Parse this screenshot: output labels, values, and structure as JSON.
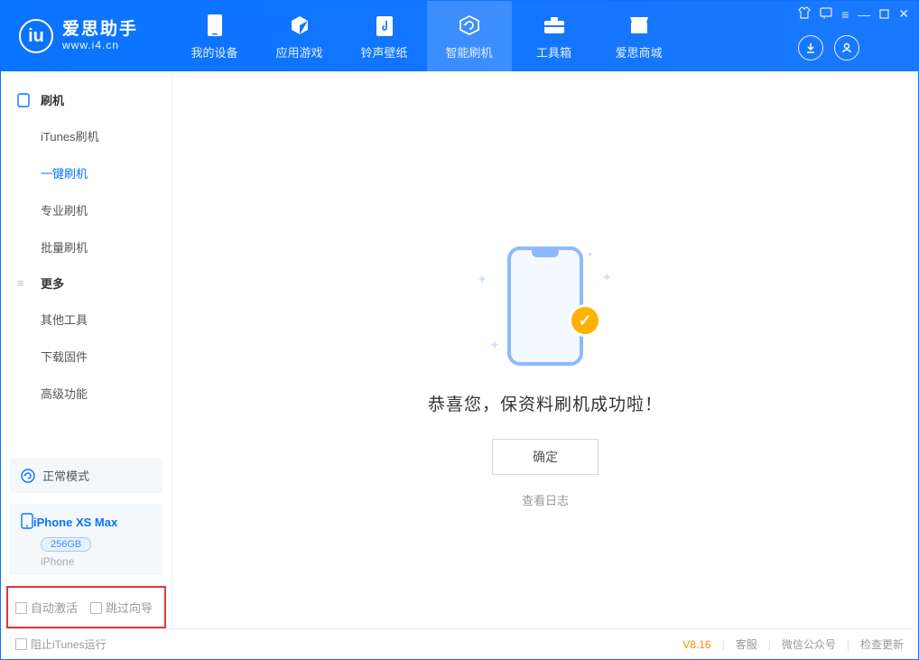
{
  "app": {
    "name": "爱思助手",
    "url": "www.i4.cn"
  },
  "header": {
    "tabs": [
      {
        "label": "我的设备",
        "icon": "phone-icon"
      },
      {
        "label": "应用游戏",
        "icon": "cube-icon"
      },
      {
        "label": "铃声壁纸",
        "icon": "music-icon"
      },
      {
        "label": "智能刷机",
        "icon": "refresh-icon",
        "active": true
      },
      {
        "label": "工具箱",
        "icon": "toolbox-icon"
      },
      {
        "label": "爱思商城",
        "icon": "store-icon"
      }
    ]
  },
  "sidebar": {
    "group1": "刷机",
    "group1_items": [
      {
        "label": "iTunes刷机"
      },
      {
        "label": "一键刷机",
        "active": true
      },
      {
        "label": "专业刷机"
      },
      {
        "label": "批量刷机"
      }
    ],
    "group2": "更多",
    "group2_items": [
      {
        "label": "其他工具"
      },
      {
        "label": "下载固件"
      },
      {
        "label": "高级功能"
      }
    ],
    "mode_label": "正常模式",
    "device": {
      "name": "iPhone XS Max",
      "storage": "256GB",
      "type": "iPhone"
    },
    "auto_activate": "自动激活",
    "skip_guide": "跳过向导"
  },
  "main": {
    "success_msg": "恭喜您，保资料刷机成功啦！",
    "ok_button": "确定",
    "view_log": "查看日志"
  },
  "footer": {
    "stop_itunes": "阻止iTunes运行",
    "version": "V8.16",
    "support": "客服",
    "wechat": "微信公众号",
    "update": "检查更新"
  }
}
